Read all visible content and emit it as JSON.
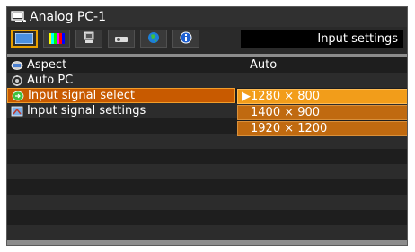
{
  "window": {
    "title": "Analog PC-1",
    "title_icon": "input-connector-icon"
  },
  "tabs": {
    "items": [
      {
        "icon": "picture-icon",
        "active": true
      },
      {
        "icon": "color-bars-icon",
        "active": false
      },
      {
        "icon": "settings-icon",
        "active": false
      },
      {
        "icon": "projector-icon",
        "active": false
      },
      {
        "icon": "globe-icon",
        "active": false
      },
      {
        "icon": "info-icon",
        "active": false
      }
    ],
    "current_title": "Input settings"
  },
  "menu": {
    "items": [
      {
        "label": "Aspect",
        "value": "Auto",
        "icon": "aspect-icon"
      },
      {
        "label": "Auto PC",
        "value": "",
        "icon": "auto-pc-icon"
      },
      {
        "label": "Input signal select",
        "value": "",
        "icon": "input-signal-icon",
        "selected": true
      },
      {
        "label": "Input signal settings",
        "value": "",
        "icon": "signal-settings-icon"
      }
    ]
  },
  "signal_options": {
    "items": [
      "1280 × 800",
      "1400 × 900",
      "1920 × 1200"
    ],
    "current_marker": "▶"
  },
  "colors": {
    "accent": "#f29d1a",
    "highlight": "#c85a00",
    "panel": "#1e1e1e"
  }
}
